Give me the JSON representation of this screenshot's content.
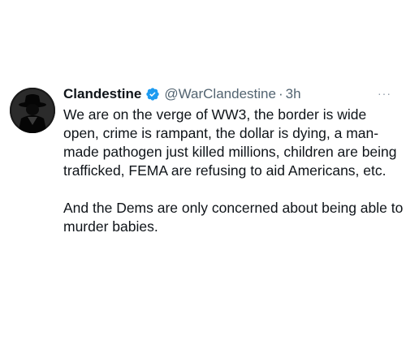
{
  "tweet": {
    "display_name": "Clandestine",
    "handle": "@WarClandestine",
    "separator": "·",
    "time": "3h",
    "more_label": "···",
    "paragraphs": [
      "We are on the verge of WW3, the border is wide open, crime is rampant, the dollar is dying, a man-made pathogen just killed millions, children are being trafficked, FEMA are refusing to aid Americans, etc.",
      "And the Dems are only concerned about being able to murder babies."
    ],
    "verified_icon": "verified-badge-icon",
    "verified_color": "#1d9bf0",
    "avatar_icon": "silhouette-hat-icon"
  }
}
